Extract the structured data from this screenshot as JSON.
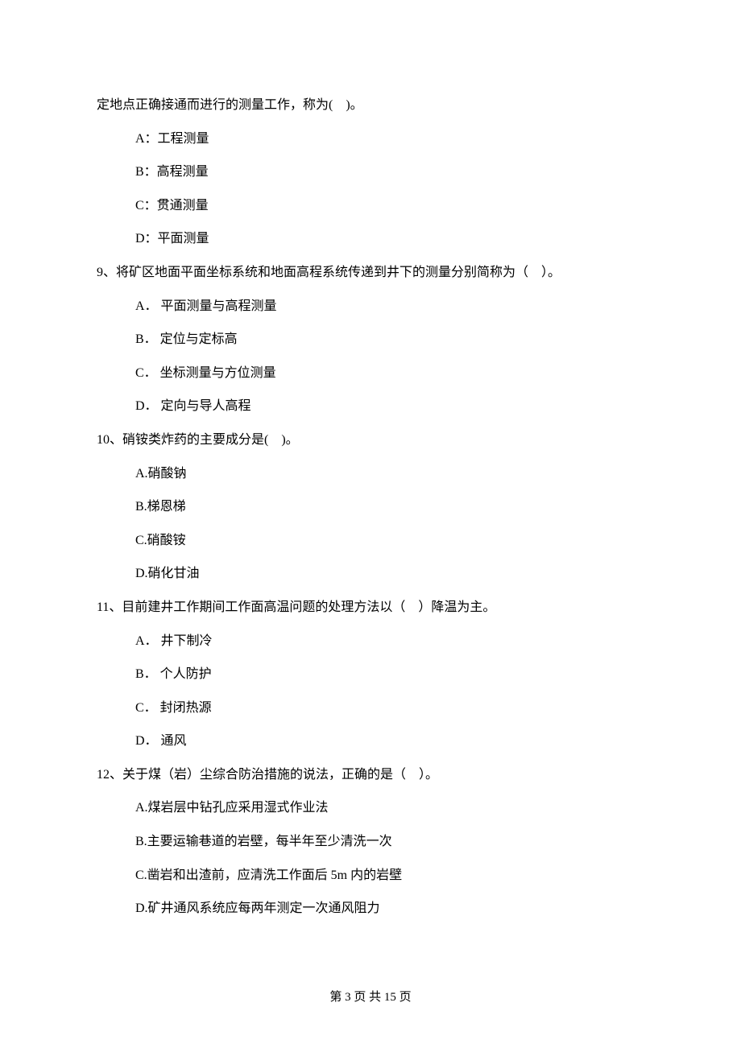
{
  "continuation_line": "定地点正确接通而进行的测量工作，称为(    )。",
  "q8": {
    "options": {
      "A": "A：工程测量",
      "B": "B：高程测量",
      "C": "C：贯通测量",
      "D": "D：平面测量"
    }
  },
  "q9": {
    "stem": "9、将矿区地面平面坐标系统和地面高程系统传递到井下的测量分别简称为（    ）。",
    "options": {
      "A": "A． 平面测量与高程测量",
      "B": "B． 定位与定标高",
      "C": "C． 坐标测量与方位测量",
      "D": "D． 定向与导人高程"
    }
  },
  "q10": {
    "stem": "10、硝铵类炸药的主要成分是(    )。",
    "options": {
      "A": "A.硝酸钠",
      "B": "B.梯恩梯",
      "C": "C.硝酸铵",
      "D": "D.硝化甘油"
    }
  },
  "q11": {
    "stem": "11、目前建井工作期间工作面高温问题的处理方法以（    ）降温为主。",
    "options": {
      "A": "A． 井下制冷",
      "B": "B． 个人防护",
      "C": "C． 封闭热源",
      "D": "D． 通风"
    }
  },
  "q12": {
    "stem": "12、关于煤（岩）尘综合防治措施的说法，正确的是（    ）。",
    "options": {
      "A": "A.煤岩层中钻孔应采用湿式作业法",
      "B": "B.主要运输巷道的岩壁，每半年至少清洗一次",
      "C": "C.凿岩和出渣前，应清洗工作面后 5m 内的岩壁",
      "D": "D.矿井通风系统应每两年测定一次通风阻力"
    }
  },
  "footer": "第 3 页 共 15 页"
}
